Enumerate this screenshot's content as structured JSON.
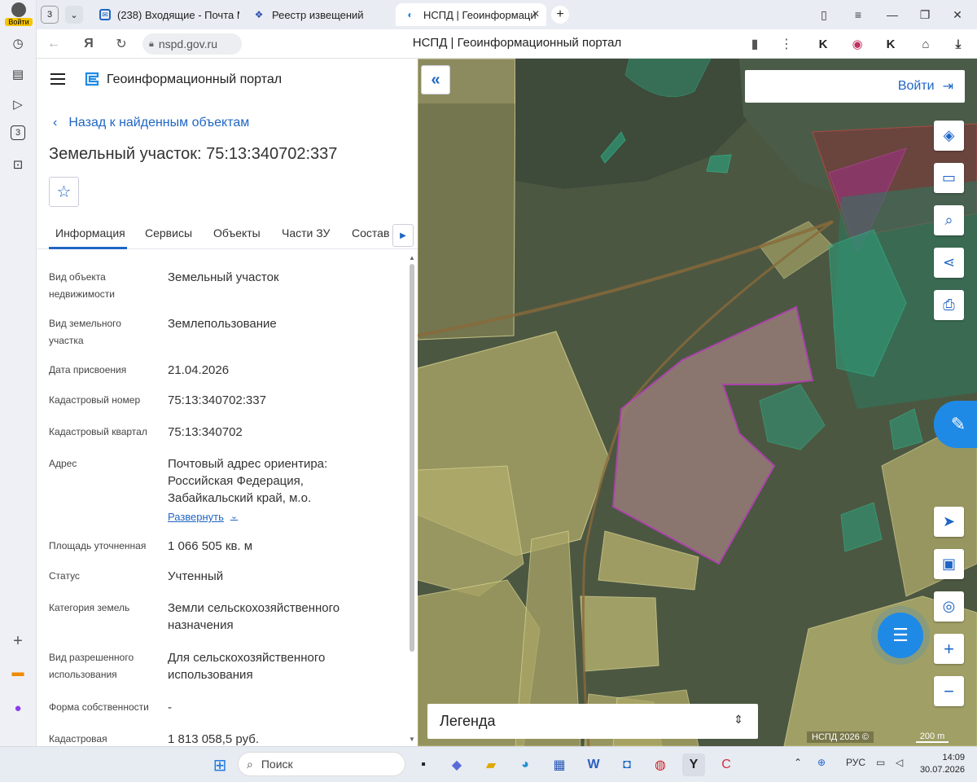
{
  "browser": {
    "profile_label": "Войти",
    "tab_count": "3",
    "tabs": [
      {
        "label": "(238) Входящие - Почта М"
      },
      {
        "label": "Реестр извещений"
      },
      {
        "label": "НСПД | Геоинформаци"
      }
    ],
    "url": "nspd.gov.ru",
    "page_title": "НСПД | Геоинформационный портал",
    "sidebar_badge": "3"
  },
  "panel": {
    "portal_name": "Геоинформационный портал",
    "back_link": "Назад к найденным объектам",
    "title": "Земельный участок: 75:13:340702:337",
    "tabs": [
      {
        "label": "Информация"
      },
      {
        "label": "Сервисы"
      },
      {
        "label": "Объекты"
      },
      {
        "label": "Части ЗУ"
      },
      {
        "label": "Состав"
      }
    ],
    "rows": [
      {
        "label": "Вид объекта недвижимости",
        "value": "Земельный участок"
      },
      {
        "label": "Вид земельного участка",
        "value": "Землепользование"
      },
      {
        "label": "Дата присвоения",
        "value": "21.04.2026"
      },
      {
        "label": "Кадастровый номер",
        "value": "75:13:340702:337"
      },
      {
        "label": "Кадастровый квартал",
        "value": "75:13:340702"
      },
      {
        "label": "Адрес",
        "value": "Почтовый адрес ориентира: Российская Федерация, Забайкальский край, м.о."
      },
      {
        "label": "Площадь уточненная",
        "value": "1 066 505 кв. м"
      },
      {
        "label": "Статус",
        "value": "Учтенный"
      },
      {
        "label": "Категория земель",
        "value": "Земли сельскохозяйственного назначения"
      },
      {
        "label": "Вид разрешенного использования",
        "value": "Для сельскохозяйственного использования"
      },
      {
        "label": "Форма собственности",
        "value": "-"
      },
      {
        "label": "Кадастровая",
        "value": "1 813 058,5 руб."
      }
    ],
    "expand_label": "Развернуть"
  },
  "map": {
    "login_label": "Войти",
    "legend_label": "Легенда",
    "attribution": "НСПД 2026 ©",
    "scale_label": "200 m"
  },
  "taskbar": {
    "search_placeholder": "Поиск",
    "lang": "РУС",
    "time": "14:09",
    "date": "30.07.2026"
  },
  "colors": {
    "accent": "#1f66c4",
    "parcel_fill": "#c9c68a",
    "selected_parcel": "#c040c0",
    "forest_outline": "#2fbf8f"
  }
}
